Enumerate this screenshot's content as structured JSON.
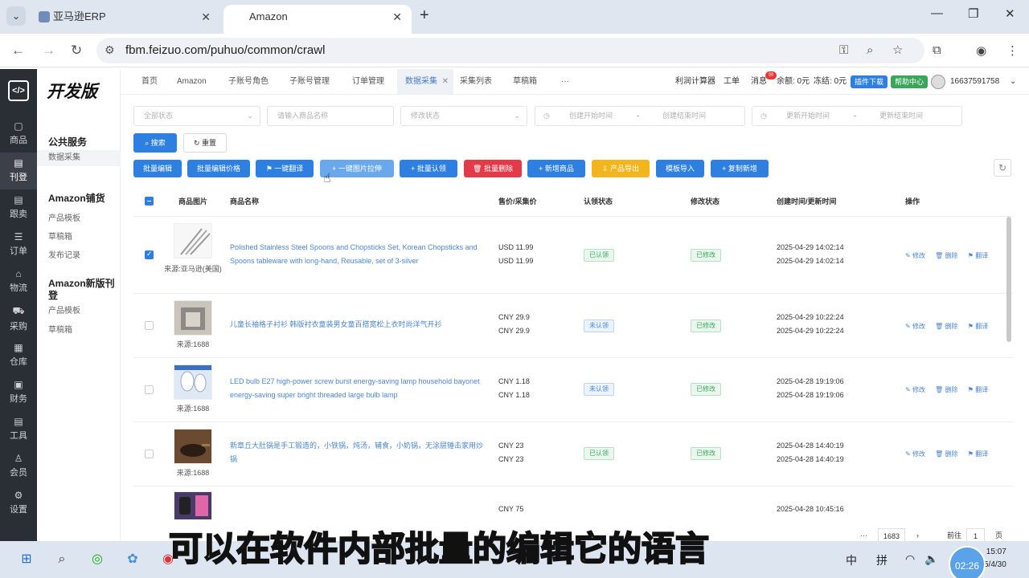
{
  "browser": {
    "tabs": [
      {
        "title": "亚马逊ERP"
      },
      {
        "title": "Amazon"
      }
    ],
    "url": "fbm.feizuo.com/puhuo/common/crawl"
  },
  "sidebar": {
    "brand": "开发版",
    "items": [
      {
        "label": "商品",
        "icon": "box-icon"
      },
      {
        "label": "刊登",
        "icon": "doc-icon"
      },
      {
        "label": "跟卖",
        "icon": "doc-icon"
      },
      {
        "label": "订单",
        "icon": "list-icon"
      },
      {
        "label": "物流",
        "icon": "home-icon"
      },
      {
        "label": "采购",
        "icon": "cart-icon"
      },
      {
        "label": "仓库",
        "icon": "warehouse-icon"
      },
      {
        "label": "财务",
        "icon": "chart-icon"
      },
      {
        "label": "工具",
        "icon": "tool-icon"
      },
      {
        "label": "会员",
        "icon": "user-icon"
      },
      {
        "label": "设置",
        "icon": "gear-icon"
      }
    ]
  },
  "subnav": {
    "group1": {
      "title": "公共服务",
      "items": [
        "数据采集"
      ]
    },
    "group2": {
      "title": "Amazon铺货",
      "items": [
        "产品模板",
        "草稿箱",
        "发布记录"
      ]
    },
    "group3": {
      "title": "Amazon新版刊登",
      "items": [
        "产品模板",
        "草稿箱"
      ]
    }
  },
  "apptabs": [
    "首页",
    "Amazon",
    "子账号角色",
    "子账号管理",
    "订单管理",
    "数据采集",
    "采集列表",
    "草稿箱",
    "···"
  ],
  "topright": {
    "calc": "利润计算器",
    "work": "工单",
    "msg": "消息",
    "balance": "余额: 0元",
    "frozen": "冻结: 0元",
    "plugin": "插件下载",
    "help": "帮助中心",
    "phone": "16637591758"
  },
  "filters": {
    "status": "全部状态",
    "name": "请输入商品名称",
    "modify": "修改状态",
    "create_start": "创建开始时间",
    "create_end": "创建结束时间",
    "update_start": "更新开始时间",
    "update_end": "更新结束时间",
    "dash": "-",
    "search": "搜索",
    "reset": "重置"
  },
  "actions": [
    "批量编辑",
    "批量编辑价格",
    "一键翻译",
    "一键图片拉伸",
    "批量认领",
    "批量删除",
    "新增商品",
    "产品导出",
    "模板导入",
    "复制新增"
  ],
  "table": {
    "headers": [
      "商品图片",
      "商品名称",
      "售价/采集价",
      "认领状态",
      "修改状态",
      "创建时间/更新时间",
      "操作"
    ],
    "rows": [
      {
        "source": "来源:亚马逊(美国)",
        "name": "Polished Stainless Steel Spoons and Chopsticks Set, Korean Chopsticks and Spoons tableware with long-hand, Reusable, set of 3-silver",
        "price1": "USD 11.99",
        "price2": "USD 11.99",
        "claim": "已认领",
        "modify": "已修改",
        "t1": "2025-04-29 14:02:14",
        "t2": "2025-04-29 14:02:14"
      },
      {
        "source": "来源:1688",
        "name": "儿童长袖格子衬衫 韩版衬衣童装男女童百搭宽松上衣时尚洋气开衫",
        "price1": "CNY 29.9",
        "price2": "CNY 29.9",
        "claim": "未认领",
        "modify": "已修改",
        "t1": "2025-04-29 10:22:24",
        "t2": "2025-04-29 10:22:24"
      },
      {
        "source": "来源:1688",
        "name": "LED bulb E27 high-power screw burst energy-saving lamp household bayonet energy-saving super bright threaded large bulb lamp",
        "price1": "CNY 1.18",
        "price2": "CNY 1.18",
        "claim": "未认领",
        "modify": "已修改",
        "t1": "2025-04-28 19:19:06",
        "t2": "2025-04-28 19:19:06"
      },
      {
        "source": "来源:1688",
        "name": "新章丘大肚锅是手工锻造的，小铁锅，炖汤，辅食，小奶锅，无涂层锤击家用炒锅",
        "price1": "CNY 23",
        "price2": "CNY 23",
        "claim": "已认领",
        "modify": "已修改",
        "t1": "2025-04-28 14:40:19",
        "t2": "2025-04-28 14:40:19"
      },
      {
        "source": "",
        "name": "",
        "price1": "CNY 75",
        "price2": "",
        "claim": "",
        "modify": "",
        "t1": "2025-04-28 10:45:16",
        "t2": ""
      }
    ],
    "ops": [
      "修改",
      "删除",
      "翻译"
    ]
  },
  "pager": {
    "ellipsis": "···",
    "last": "1683",
    "goto": "前往",
    "page": "1",
    "unit": "页"
  },
  "subtitle": {
    "white": "可以在软件内部批量的",
    "yellow": "编辑它的语言"
  },
  "taskbar": {
    "ime1": "中",
    "ime2": "拼",
    "time": "15:07",
    "date": "5/4/30",
    "rec": "02:26"
  }
}
